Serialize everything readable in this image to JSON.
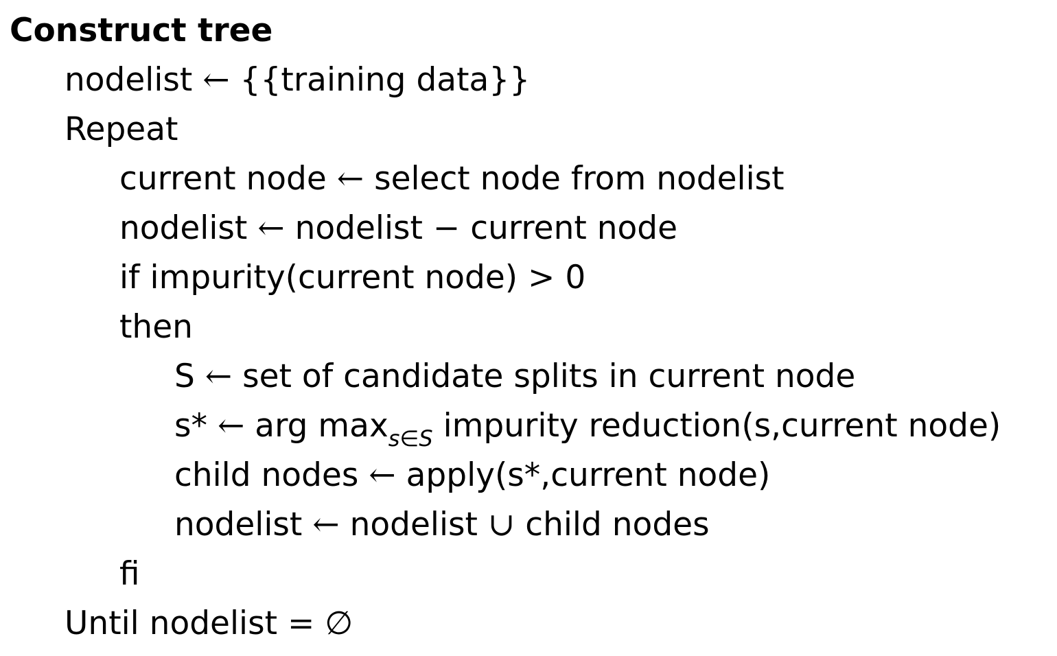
{
  "title": "Construct tree",
  "lines": {
    "nodelist_init": {
      "lhs": "nodelist",
      "arrow": "←",
      "rhs": "{{training data}}"
    },
    "repeat": "Repeat",
    "select": {
      "lhs": "current node",
      "arrow": "←",
      "rhs": "select node from nodelist"
    },
    "remove": {
      "lhs": "nodelist",
      "arrow": "←",
      "a": "nodelist",
      "op": "−",
      "b": "current node"
    },
    "if": {
      "text": "if impurity(current node)",
      "op": ">",
      "value": "0"
    },
    "then": "then",
    "splits": {
      "lhs": "S",
      "arrow": "←",
      "rhs": "set of candidate splits in current node"
    },
    "best": {
      "lhs": "s*",
      "arrow": "←",
      "func": "arg max",
      "sub": "s∈S",
      "rhs": "impurity reduction(s,current node)"
    },
    "apply": {
      "lhs": "child nodes",
      "arrow": "←",
      "rhs": "apply(s*,current node)"
    },
    "union": {
      "lhs": "nodelist",
      "arrow": "←",
      "a": "nodelist",
      "op": "∪",
      "b": "child nodes"
    },
    "fi": "fi",
    "until": {
      "text": "Until nodelist",
      "op": "=",
      "value": "∅"
    }
  }
}
